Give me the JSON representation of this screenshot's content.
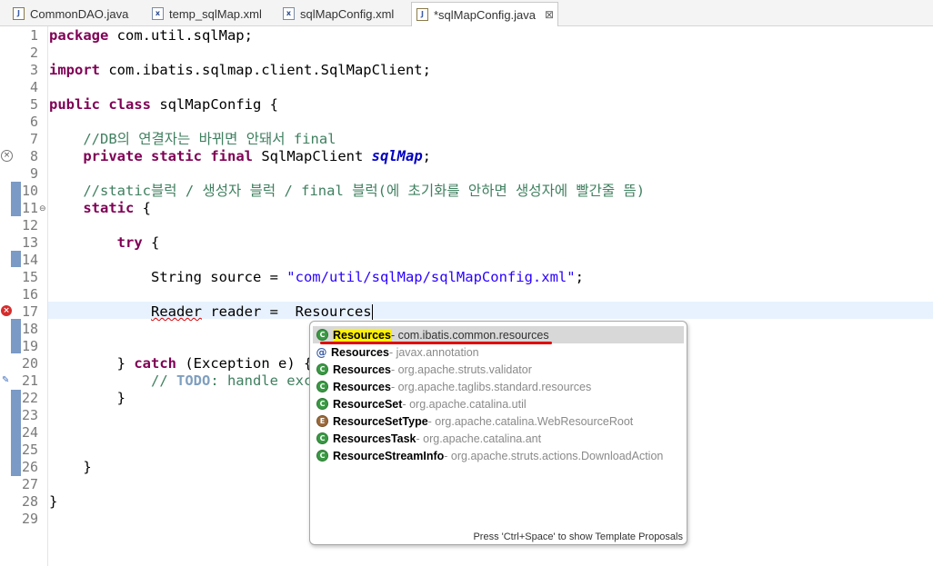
{
  "tabs": [
    {
      "label": "CommonDAO.java",
      "icon": "java-file-icon"
    },
    {
      "label": "temp_sqlMap.xml",
      "icon": "xml-file-icon"
    },
    {
      "label": "sqlMapConfig.xml",
      "icon": "xml-file-icon"
    },
    {
      "label": "*sqlMapConfig.java",
      "icon": "java-file-icon",
      "active": true,
      "close": "⊠"
    }
  ],
  "lines": [
    "1",
    "2",
    "3",
    "4",
    "5",
    "6",
    "7",
    "8",
    "9",
    "10",
    "11",
    "12",
    "13",
    "14",
    "15",
    "16",
    "17",
    "18",
    "19",
    "20",
    "21",
    "22",
    "23",
    "24",
    "25",
    "26",
    "27",
    "28",
    "29"
  ],
  "code": {
    "l1_kw": "package",
    "l1_rest": " com.util.sqlMap;",
    "l3_kw": "import",
    "l3_rest": " com.ibatis.sqlmap.client.SqlMapClient;",
    "l5_kw1": "public",
    "l5_kw2": "class",
    "l5_rest": " sqlMapConfig {",
    "l7_comment": "    //DB의 연결자는 바뀌면 안돼서 final",
    "l8_indent": "    ",
    "l8_kw1": "private",
    "l8_kw2": "static",
    "l8_kw3": "final",
    "l8_type": " SqlMapClient ",
    "l8_field": "sqlMap",
    "l8_end": ";",
    "l10_comment": "    //static블럭 / 생성자 블럭 / final 블럭(에 초기화를 안하면 생성자에 빨간줄 뜸)",
    "l11_indent": "    ",
    "l11_kw": "static",
    "l11_rest": " {",
    "l13_indent": "        ",
    "l13_kw": "try",
    "l13_rest": " {",
    "l15_indent": "            ",
    "l15_pre": "String source = ",
    "l15_str": "\"com/util/sqlMap/sqlMapConfig.xml\"",
    "l15_end": ";",
    "l17_indent": "            ",
    "l17_type": "Reader",
    " l17_sp": " ",
    "l17_mid": " reader =  ",
    "l17_typed": "Resources",
    "l20_indent": "        ",
    "l20_pre": "} ",
    "l20_kw": "catch",
    "l20_rest": " (Exception e) {",
    "l21_indent": "            ",
    "l21_pre": "// ",
    "l21_todo": "TODO",
    "l21_rest": ": handle exce",
    "l22_text": "        }",
    "l26_text": "    }",
    "l28_text": "}"
  },
  "proposals": [
    {
      "icon": "class-icon",
      "glyph": "C",
      "name": "Resources",
      "pkg": " - com.ibatis.common.resources",
      "selected": true
    },
    {
      "icon": "annotation-icon",
      "glyph": "@",
      "name": "Resources",
      "pkg": " - javax.annotation"
    },
    {
      "icon": "class-icon",
      "glyph": "C",
      "name": "Resources",
      "pkg": " - org.apache.struts.validator"
    },
    {
      "icon": "class-icon",
      "glyph": "C",
      "name": "Resources",
      "pkg": " - org.apache.taglibs.standard.resources"
    },
    {
      "icon": "class-icon",
      "glyph": "C",
      "name": "ResourceSet",
      "pkg": " - org.apache.catalina.util"
    },
    {
      "icon": "enum-icon",
      "glyph": "E",
      "name": "ResourceSetType",
      "pkg": " - org.apache.catalina.WebResourceRoot"
    },
    {
      "icon": "class-icon",
      "glyph": "C",
      "name": "ResourcesTask",
      "pkg": " - org.apache.catalina.ant"
    },
    {
      "icon": "class-icon",
      "glyph": "C",
      "name": "ResourceStreamInfo",
      "pkg": " - org.apache.struts.actions.DownloadAction"
    }
  ],
  "popup_footer": "Press 'Ctrl+Space' to show Template Proposals",
  "colors": {
    "keyword": "#7f0055",
    "comment": "#3f7f5f",
    "string": "#2a00ff",
    "field": "#0000c0",
    "selection_underline": "#e00000",
    "highlight": "#fff200"
  }
}
